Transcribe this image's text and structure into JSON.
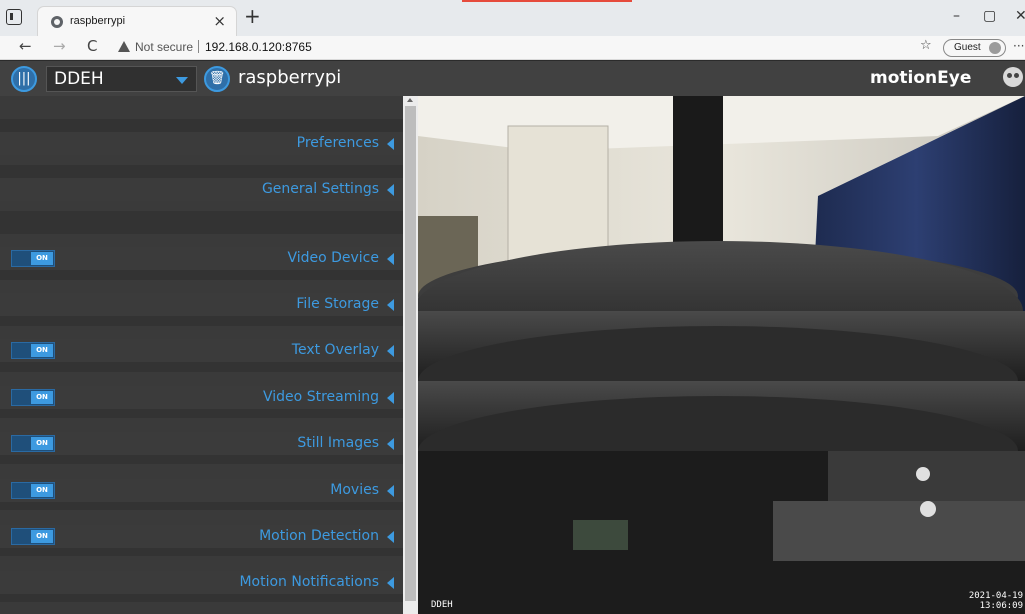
{
  "browser": {
    "tab_title": "raspberrypi",
    "tab_close": "×",
    "new_tab": "+",
    "minimize": "–",
    "maximize": "▢",
    "close_window": "✕",
    "back": "←",
    "forward": "→",
    "reload": "C",
    "security_label": "Not secure",
    "url": "192.168.0.120:8765",
    "favorites_icon": "star-list-icon",
    "profile_label": "Guest",
    "more": "···"
  },
  "header": {
    "camera_select_value": "DDEH",
    "camera_name": "raspberrypi",
    "brand": "motionEye"
  },
  "settings": {
    "sections": [
      {
        "label": "Preferences",
        "toggle": null
      },
      {
        "label": "General Settings",
        "toggle": null
      },
      {
        "label": "Video Device",
        "toggle": "ON"
      },
      {
        "label": "File Storage",
        "toggle": null
      },
      {
        "label": "Text Overlay",
        "toggle": "ON"
      },
      {
        "label": "Video Streaming",
        "toggle": "ON"
      },
      {
        "label": "Still Images",
        "toggle": "ON"
      },
      {
        "label": "Movies",
        "toggle": "ON"
      },
      {
        "label": "Motion Detection",
        "toggle": "ON"
      },
      {
        "label": "Motion Notifications",
        "toggle": null
      }
    ]
  },
  "camera_view": {
    "overlay_left": "DDEH",
    "overlay_date": "2021-04-19",
    "overlay_time": "13:06:09"
  },
  "colors": {
    "accent": "#3d9ae0",
    "header_bg": "#414141",
    "panel_bg": "#2f2f2f"
  }
}
